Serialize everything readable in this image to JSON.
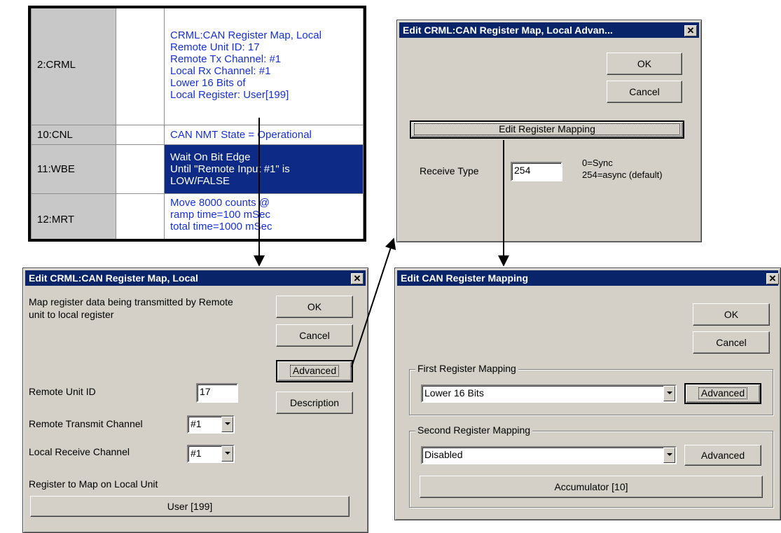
{
  "listing": {
    "rows": [
      {
        "num": "2:CRML",
        "lines": [
          "CRML:CAN Register Map, Local",
          "Remote Unit ID:  17",
          "Remote Tx Channel:  #1",
          "Local Rx Channel:  #1",
          "Lower 16 Bits of",
          "Local Register:  User[199]"
        ]
      },
      {
        "num": "10:CNL",
        "lines": [
          "CAN NMT State = Operational"
        ]
      },
      {
        "num": "11:WBE",
        "lines": [
          "Wait On Bit Edge",
          "Until \"Remote Input #1\" is",
          "LOW/FALSE"
        ],
        "selected": true
      },
      {
        "num": "12:MRT",
        "lines": [
          "Move 8000 counts @",
          "ramp time=100 mSec",
          "total time=1000 mSec"
        ]
      }
    ]
  },
  "dlg_local_adv": {
    "title": "Edit CRML:CAN Register Map, Local Advan...",
    "ok": "OK",
    "cancel": "Cancel",
    "edit_mapping": "Edit Register Mapping",
    "receive_type_label": "Receive Type",
    "receive_type_value": "254",
    "hint_line1": "0=Sync",
    "hint_line2": "254=async (default)"
  },
  "dlg_local": {
    "title": "Edit CRML:CAN Register Map, Local",
    "description": [
      "Map register data being transmitted by Remote",
      "unit to local register"
    ],
    "ok": "OK",
    "cancel": "Cancel",
    "advanced": "Advanced",
    "description_btn": "Description",
    "remote_unit_label": "Remote Unit ID",
    "remote_unit_value": "17",
    "remote_tx_label": "Remote Transmit Channel",
    "remote_tx_value": "#1",
    "local_rx_label": "Local Receive Channel",
    "local_rx_value": "#1",
    "register_label": "Register to Map on Local Unit",
    "register_value": "User [199]"
  },
  "dlg_mapping": {
    "title": "Edit CAN Register Mapping",
    "ok": "OK",
    "cancel": "Cancel",
    "first_group": "First Register Mapping",
    "first_value": "Lower 16 Bits",
    "first_advanced": "Advanced",
    "second_group": "Second Register Mapping",
    "second_value": "Disabled",
    "second_advanced": "Advanced",
    "accumulator": "Accumulator [10]"
  }
}
